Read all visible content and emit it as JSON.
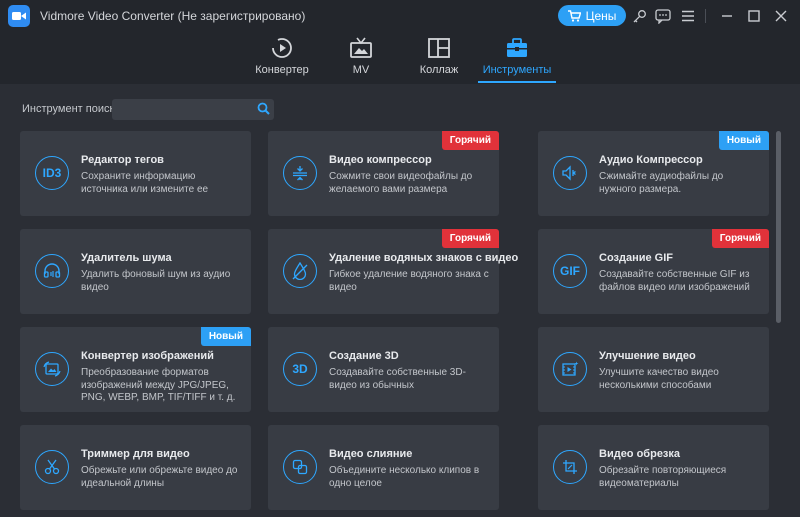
{
  "window": {
    "title": "Vidmore Video Converter  (Не зарегистрировано)",
    "price_label": "Цены"
  },
  "nav": {
    "tabs": [
      {
        "label": "Конвертер",
        "icon": "converter-icon"
      },
      {
        "label": "MV",
        "icon": "mv-icon"
      },
      {
        "label": "Коллаж",
        "icon": "collage-icon"
      },
      {
        "label": "Инструменты",
        "icon": "toolbox-icon",
        "active": true
      }
    ]
  },
  "search": {
    "label": "Инструмент поиска:",
    "value": "",
    "placeholder": ""
  },
  "tools": [
    {
      "title": "Редактор тегов",
      "desc": "Сохраните информацию источника или измените ее",
      "icon": "id3-icon",
      "glyph": "ID3",
      "badge": ""
    },
    {
      "title": "Видео компрессор",
      "desc": "Сожмите свои видеофайлы до желаемого вами размера",
      "icon": "compress-icon",
      "glyph": "",
      "badge": "Горячий"
    },
    {
      "title": "Аудио Компрессор",
      "desc": "Сжимайте аудиофайлы до нужного размера.",
      "icon": "audio-compress-icon",
      "glyph": "",
      "badge": "Новый"
    },
    {
      "title": "Удалитель шума",
      "desc": "Удалить фоновый шум из аудио видео",
      "icon": "headphones-icon",
      "glyph": "",
      "badge": ""
    },
    {
      "title": "Удаление водяных знаков с видео",
      "desc": "Гибкое удаление водяного знака с видео",
      "icon": "watermark-drop-icon",
      "glyph": "",
      "badge": "Горячий"
    },
    {
      "title": "Создание GIF",
      "desc": "Создавайте собственные GIF из файлов видео или изображений",
      "icon": "gif-icon",
      "glyph": "GIF",
      "badge": "Горячий"
    },
    {
      "title": "Конвертер изображений",
      "desc": "Преобразование форматов изображений между JPG/JPEG, PNG, WEBP, BMP, TIF/TIFF и т. д.",
      "icon": "image-convert-icon",
      "glyph": "",
      "badge": "Новый"
    },
    {
      "title": "Создание 3D",
      "desc": "Создавайте собственные 3D-видео из обычных",
      "icon": "3d-icon",
      "glyph": "3D",
      "badge": ""
    },
    {
      "title": "Улучшение видео",
      "desc": "Улучшите качество видео несколькими способами",
      "icon": "enhance-icon",
      "glyph": "",
      "badge": ""
    },
    {
      "title": "Триммер для видео",
      "desc": "Обрежьте или обрежьте видео до идеальной длины",
      "icon": "scissors-icon",
      "glyph": "",
      "badge": ""
    },
    {
      "title": "Видео слияние",
      "desc": "Объедините несколько клипов в одно целое",
      "icon": "merge-icon",
      "glyph": "",
      "badge": ""
    },
    {
      "title": "Видео обрезка",
      "desc": "Обрезайте повторяющиеся видеоматериалы",
      "icon": "crop-icon",
      "glyph": "",
      "badge": ""
    }
  ],
  "colors": {
    "accent": "#2ea7ff",
    "hot_badge": "#e1323a",
    "new_badge": "#2da0f5",
    "card_bg": "#383c44",
    "page_bg": "#2b2e35"
  }
}
